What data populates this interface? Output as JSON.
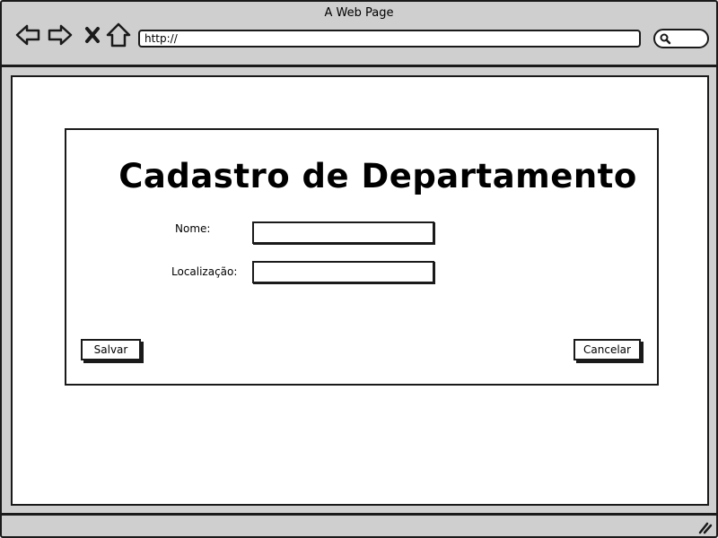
{
  "window": {
    "title": "A Web Page"
  },
  "toolbar": {
    "icons": [
      "back-arrow-icon",
      "forward-arrow-icon",
      "stop-icon",
      "home-icon"
    ],
    "address": "http://",
    "search_icon": "search-icon"
  },
  "form": {
    "title": "Cadastro de Departamento",
    "fields": {
      "nome": {
        "label": "Nome:",
        "value": ""
      },
      "localizacao": {
        "label": "Localização:",
        "value": ""
      }
    },
    "buttons": {
      "salvar": "Salvar",
      "cancelar": "Cancelar"
    }
  },
  "colors": {
    "chrome": "#cfcfcf",
    "ink": "#1a1a1a",
    "background": "#ffffff"
  }
}
